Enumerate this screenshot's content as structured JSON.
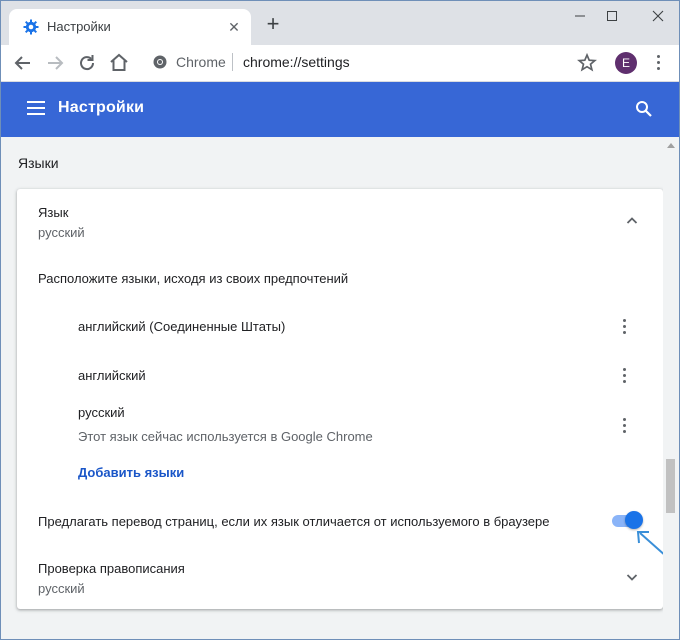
{
  "tab": {
    "title": "Настройки",
    "favicon": "gear-icon"
  },
  "toolbar": {
    "omnibox_site": "Chrome",
    "url": "chrome://settings",
    "avatar_letter": "E"
  },
  "header": {
    "title": "Настройки"
  },
  "section": {
    "title": "Языки"
  },
  "language": {
    "label": "Язык",
    "value": "русский",
    "order_text": "Расположите языки, исходя из своих предпочтений",
    "items": [
      {
        "name": "английский (Соединенные Штаты)",
        "note": ""
      },
      {
        "name": "английский",
        "note": ""
      },
      {
        "name": "русский",
        "note": "Этот язык сейчас используется в Google Chrome"
      }
    ],
    "add_link": "Добавить языки"
  },
  "translate": {
    "label": "Предлагать перевод страниц, если их язык отличается от используемого в браузере",
    "enabled": true
  },
  "spellcheck": {
    "label": "Проверка правописания",
    "value": "русский"
  },
  "colors": {
    "header": "#3767d6",
    "accent": "#1a73e8",
    "link": "#1a56c8"
  }
}
